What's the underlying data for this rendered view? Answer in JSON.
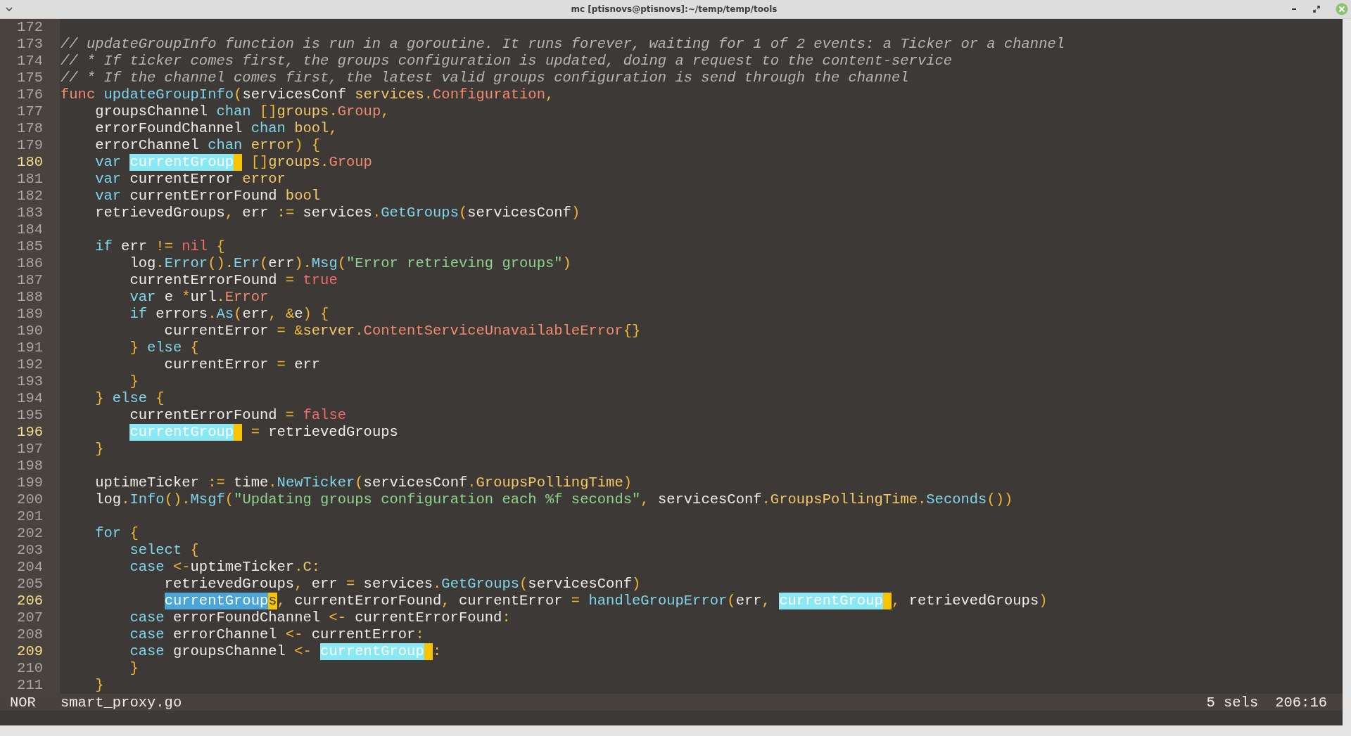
{
  "window": {
    "title": "mc [ptisnovs@ptisnovs]:~/temp/temp/tools"
  },
  "lines": [
    {
      "number": "172",
      "current": false
    },
    {
      "number": "173",
      "current": false,
      "tokens": [
        {
          "kind": "comment",
          "text": "// updateGroupInfo function is run in a goroutine. It runs forever, waiting for 1 of 2 events: a Ticker or a channel"
        }
      ]
    },
    {
      "number": "174",
      "current": false,
      "tokens": [
        {
          "kind": "comment",
          "text": "// * If ticker comes first, the groups configuration is updated, doing a request to the content-service"
        }
      ]
    },
    {
      "number": "175",
      "current": false,
      "tokens": [
        {
          "kind": "comment",
          "text": "// * If the channel comes first, the latest valid groups configuration is send through the channel"
        }
      ]
    },
    {
      "number": "176",
      "current": false,
      "tokens": [
        {
          "kind": "type",
          "text": "func"
        },
        {
          "kind": "func",
          "text": " updateGroupInfo"
        },
        {
          "kind": "op",
          "text": "("
        },
        {
          "kind": "plain",
          "text": "servicesConf"
        },
        {
          "kind": "builtin",
          "text": " services"
        },
        {
          "kind": "op",
          "text": "."
        },
        {
          "kind": "type",
          "text": "Configuration"
        },
        {
          "kind": "op",
          "text": ","
        }
      ]
    },
    {
      "number": "177",
      "current": false,
      "tokens": [
        {
          "kind": "plain",
          "text": "    groupsChannel"
        },
        {
          "kind": "keyword",
          "text": " chan"
        },
        {
          "kind": "op",
          "text": " []"
        },
        {
          "kind": "builtin",
          "text": "groups"
        },
        {
          "kind": "op",
          "text": "."
        },
        {
          "kind": "type",
          "text": "Group"
        },
        {
          "kind": "op",
          "text": ","
        }
      ]
    },
    {
      "number": "178",
      "current": false,
      "tokens": [
        {
          "kind": "plain",
          "text": "    errorFoundChannel"
        },
        {
          "kind": "keyword",
          "text": " chan"
        },
        {
          "kind": "builtin",
          "text": " bool"
        },
        {
          "kind": "op",
          "text": ","
        }
      ]
    },
    {
      "number": "179",
      "current": false,
      "tokens": [
        {
          "kind": "plain",
          "text": "    errorChannel"
        },
        {
          "kind": "keyword",
          "text": " chan"
        },
        {
          "kind": "builtin",
          "text": " error"
        },
        {
          "kind": "op",
          "text": ") {"
        }
      ]
    },
    {
      "number": "180",
      "current": true,
      "tokens": [
        {
          "kind": "keyword",
          "text": "    var"
        },
        {
          "kind": "selection",
          "text": " currentGroup",
          "cursor": true
        },
        {
          "kind": "op",
          "text": " []"
        },
        {
          "kind": "builtin",
          "text": "groups"
        },
        {
          "kind": "op",
          "text": "."
        },
        {
          "kind": "type",
          "text": "Group"
        }
      ]
    },
    {
      "number": "181",
      "current": false,
      "tokens": [
        {
          "kind": "keyword",
          "text": "    var"
        },
        {
          "kind": "plain",
          "text": " currentError"
        },
        {
          "kind": "builtin",
          "text": " error"
        }
      ]
    },
    {
      "number": "182",
      "current": false,
      "tokens": [
        {
          "kind": "keyword",
          "text": "    var"
        },
        {
          "kind": "plain",
          "text": " currentErrorFound"
        },
        {
          "kind": "builtin",
          "text": " bool"
        }
      ]
    },
    {
      "number": "183",
      "current": false,
      "tokens": [
        {
          "kind": "plain",
          "text": "    retrievedGroups"
        },
        {
          "kind": "op",
          "text": ","
        },
        {
          "kind": "plain",
          "text": " err"
        },
        {
          "kind": "op",
          "text": " :="
        },
        {
          "kind": "plain",
          "text": " services"
        },
        {
          "kind": "op",
          "text": "."
        },
        {
          "kind": "func",
          "text": "GetGroups"
        },
        {
          "kind": "op",
          "text": "("
        },
        {
          "kind": "plain",
          "text": "servicesConf"
        },
        {
          "kind": "op",
          "text": ")"
        }
      ]
    },
    {
      "number": "184",
      "current": false
    },
    {
      "number": "185",
      "current": false,
      "tokens": [
        {
          "kind": "keyword",
          "text": "    if"
        },
        {
          "kind": "plain",
          "text": " err"
        },
        {
          "kind": "op",
          "text": " !="
        },
        {
          "kind": "constant",
          "text": " nil"
        },
        {
          "kind": "op",
          "text": " {"
        }
      ]
    },
    {
      "number": "186",
      "current": false,
      "tokens": [
        {
          "kind": "plain",
          "text": "        log"
        },
        {
          "kind": "op",
          "text": "."
        },
        {
          "kind": "func",
          "text": "Error"
        },
        {
          "kind": "op",
          "text": "()."
        },
        {
          "kind": "func",
          "text": "Err"
        },
        {
          "kind": "op",
          "text": "("
        },
        {
          "kind": "plain",
          "text": "err"
        },
        {
          "kind": "op",
          "text": ")."
        },
        {
          "kind": "func",
          "text": "Msg"
        },
        {
          "kind": "op",
          "text": "("
        },
        {
          "kind": "string",
          "text": "\"Error retrieving groups\""
        },
        {
          "kind": "op",
          "text": ")"
        }
      ]
    },
    {
      "number": "187",
      "current": false,
      "tokens": [
        {
          "kind": "plain",
          "text": "        currentErrorFound"
        },
        {
          "kind": "op",
          "text": " ="
        },
        {
          "kind": "constant",
          "text": " true"
        }
      ]
    },
    {
      "number": "188",
      "current": false,
      "tokens": [
        {
          "kind": "keyword",
          "text": "        var"
        },
        {
          "kind": "plain",
          "text": " e"
        },
        {
          "kind": "op",
          "text": " *"
        },
        {
          "kind": "plain",
          "text": "url"
        },
        {
          "kind": "op",
          "text": "."
        },
        {
          "kind": "type",
          "text": "Error"
        }
      ]
    },
    {
      "number": "189",
      "current": false,
      "tokens": [
        {
          "kind": "keyword",
          "text": "        if"
        },
        {
          "kind": "plain",
          "text": " errors"
        },
        {
          "kind": "op",
          "text": "."
        },
        {
          "kind": "func",
          "text": "As"
        },
        {
          "kind": "op",
          "text": "("
        },
        {
          "kind": "plain",
          "text": "err"
        },
        {
          "kind": "op",
          "text": ", &"
        },
        {
          "kind": "plain",
          "text": "e"
        },
        {
          "kind": "op",
          "text": ") {"
        }
      ]
    },
    {
      "number": "190",
      "current": false,
      "tokens": [
        {
          "kind": "plain",
          "text": "            currentError"
        },
        {
          "kind": "op",
          "text": " = &"
        },
        {
          "kind": "builtin",
          "text": "server"
        },
        {
          "kind": "op",
          "text": "."
        },
        {
          "kind": "type",
          "text": "ContentServiceUnavailableError"
        },
        {
          "kind": "op",
          "text": "{}"
        }
      ]
    },
    {
      "number": "191",
      "current": false,
      "tokens": [
        {
          "kind": "op",
          "text": "        }"
        },
        {
          "kind": "keyword",
          "text": " else"
        },
        {
          "kind": "op",
          "text": " {"
        }
      ]
    },
    {
      "number": "192",
      "current": false,
      "tokens": [
        {
          "kind": "plain",
          "text": "            currentError"
        },
        {
          "kind": "op",
          "text": " ="
        },
        {
          "kind": "plain",
          "text": " err"
        }
      ]
    },
    {
      "number": "193",
      "current": false,
      "tokens": [
        {
          "kind": "op",
          "text": "        }"
        }
      ]
    },
    {
      "number": "194",
      "current": false,
      "tokens": [
        {
          "kind": "op",
          "text": "    }"
        },
        {
          "kind": "keyword",
          "text": " else"
        },
        {
          "kind": "op",
          "text": " {"
        }
      ]
    },
    {
      "number": "195",
      "current": false,
      "tokens": [
        {
          "kind": "plain",
          "text": "        currentErrorFound"
        },
        {
          "kind": "op",
          "text": " ="
        },
        {
          "kind": "constant",
          "text": " false"
        }
      ]
    },
    {
      "number": "196",
      "current": true,
      "tokens": [
        {
          "kind": "selection",
          "text": "        currentGroup",
          "cursor": true
        },
        {
          "kind": "op",
          "text": " ="
        },
        {
          "kind": "plain",
          "text": " retrievedGroups"
        }
      ]
    },
    {
      "number": "197",
      "current": false,
      "tokens": [
        {
          "kind": "op",
          "text": "    }"
        }
      ]
    },
    {
      "number": "198",
      "current": false
    },
    {
      "number": "199",
      "current": false,
      "tokens": [
        {
          "kind": "plain",
          "text": "    uptimeTicker"
        },
        {
          "kind": "op",
          "text": " :="
        },
        {
          "kind": "plain",
          "text": " time"
        },
        {
          "kind": "op",
          "text": "."
        },
        {
          "kind": "func",
          "text": "NewTicker"
        },
        {
          "kind": "op",
          "text": "("
        },
        {
          "kind": "plain",
          "text": "servicesConf"
        },
        {
          "kind": "op",
          "text": "."
        },
        {
          "kind": "builtin",
          "text": "GroupsPollingTime"
        },
        {
          "kind": "op",
          "text": ")"
        }
      ]
    },
    {
      "number": "200",
      "current": false,
      "tokens": [
        {
          "kind": "plain",
          "text": "    log"
        },
        {
          "kind": "op",
          "text": "."
        },
        {
          "kind": "func",
          "text": "Info"
        },
        {
          "kind": "op",
          "text": "()."
        },
        {
          "kind": "func",
          "text": "Msgf"
        },
        {
          "kind": "op",
          "text": "("
        },
        {
          "kind": "string",
          "text": "\"Updating groups configuration each %f seconds\""
        },
        {
          "kind": "op",
          "text": ","
        },
        {
          "kind": "plain",
          "text": " servicesConf"
        },
        {
          "kind": "op",
          "text": "."
        },
        {
          "kind": "builtin",
          "text": "GroupsPollingTime"
        },
        {
          "kind": "op",
          "text": "."
        },
        {
          "kind": "func",
          "text": "Seconds"
        },
        {
          "kind": "op",
          "text": "())"
        }
      ]
    },
    {
      "number": "201",
      "current": false
    },
    {
      "number": "202",
      "current": false,
      "tokens": [
        {
          "kind": "keyword",
          "text": "    for"
        },
        {
          "kind": "op",
          "text": " {"
        }
      ]
    },
    {
      "number": "203",
      "current": false,
      "tokens": [
        {
          "kind": "keyword",
          "text": "        select"
        },
        {
          "kind": "op",
          "text": " {"
        }
      ]
    },
    {
      "number": "204",
      "current": false,
      "tokens": [
        {
          "kind": "keyword",
          "text": "        case"
        },
        {
          "kind": "op",
          "text": " <-"
        },
        {
          "kind": "plain",
          "text": "uptimeTicker"
        },
        {
          "kind": "op",
          "text": "."
        },
        {
          "kind": "builtin",
          "text": "C"
        },
        {
          "kind": "op",
          "text": ":"
        }
      ]
    },
    {
      "number": "205",
      "current": false,
      "tokens": [
        {
          "kind": "plain",
          "text": "            retrievedGroups"
        },
        {
          "kind": "op",
          "text": ","
        },
        {
          "kind": "plain",
          "text": " err"
        },
        {
          "kind": "op",
          "text": " ="
        },
        {
          "kind": "plain",
          "text": " services"
        },
        {
          "kind": "op",
          "text": "."
        },
        {
          "kind": "func",
          "text": "GetGroups"
        },
        {
          "kind": "op",
          "text": "("
        },
        {
          "kind": "plain",
          "text": "servicesConf"
        },
        {
          "kind": "op",
          "text": ")"
        }
      ]
    },
    {
      "number": "206",
      "current": true,
      "tokens": [
        {
          "kind": "primary-selection",
          "text": "            currentGroup"
        },
        {
          "kind": "cursor",
          "text": "s"
        },
        {
          "kind": "op",
          "text": ","
        },
        {
          "kind": "plain",
          "text": " currentErrorFound"
        },
        {
          "kind": "op",
          "text": ","
        },
        {
          "kind": "plain",
          "text": " currentError"
        },
        {
          "kind": "op",
          "text": " ="
        },
        {
          "kind": "func",
          "text": " handleGroupError"
        },
        {
          "kind": "op",
          "text": "("
        },
        {
          "kind": "plain",
          "text": "err"
        },
        {
          "kind": "op",
          "text": ","
        },
        {
          "kind": "selection",
          "text": " currentGroup",
          "cursor": true
        },
        {
          "kind": "op",
          "text": ","
        },
        {
          "kind": "plain",
          "text": " retrievedGroups"
        },
        {
          "kind": "op",
          "text": ")"
        }
      ]
    },
    {
      "number": "207",
      "current": false,
      "tokens": [
        {
          "kind": "keyword",
          "text": "        case"
        },
        {
          "kind": "plain",
          "text": " errorFoundChannel"
        },
        {
          "kind": "op",
          "text": " <-"
        },
        {
          "kind": "plain",
          "text": " currentErrorFound"
        },
        {
          "kind": "op",
          "text": ":"
        }
      ]
    },
    {
      "number": "208",
      "current": false,
      "tokens": [
        {
          "kind": "keyword",
          "text": "        case"
        },
        {
          "kind": "plain",
          "text": " errorChannel"
        },
        {
          "kind": "op",
          "text": " <-"
        },
        {
          "kind": "plain",
          "text": " currentError"
        },
        {
          "kind": "op",
          "text": ":"
        }
      ]
    },
    {
      "number": "209",
      "current": true,
      "tokens": [
        {
          "kind": "keyword",
          "text": "        case"
        },
        {
          "kind": "plain",
          "text": " groupsChannel"
        },
        {
          "kind": "op",
          "text": " <-"
        },
        {
          "kind": "selection",
          "text": " currentGroup",
          "cursor": true
        },
        {
          "kind": "op",
          "text": ":"
        }
      ]
    },
    {
      "number": "210",
      "current": false,
      "tokens": [
        {
          "kind": "op",
          "text": "        }"
        }
      ]
    },
    {
      "number": "211",
      "current": false,
      "tokens": [
        {
          "kind": "op",
          "text": "    }"
        }
      ]
    }
  ],
  "status_bar": {
    "mode": "NOR",
    "file": "smart_proxy.go",
    "selections": "5 sels",
    "position": "206:16"
  }
}
